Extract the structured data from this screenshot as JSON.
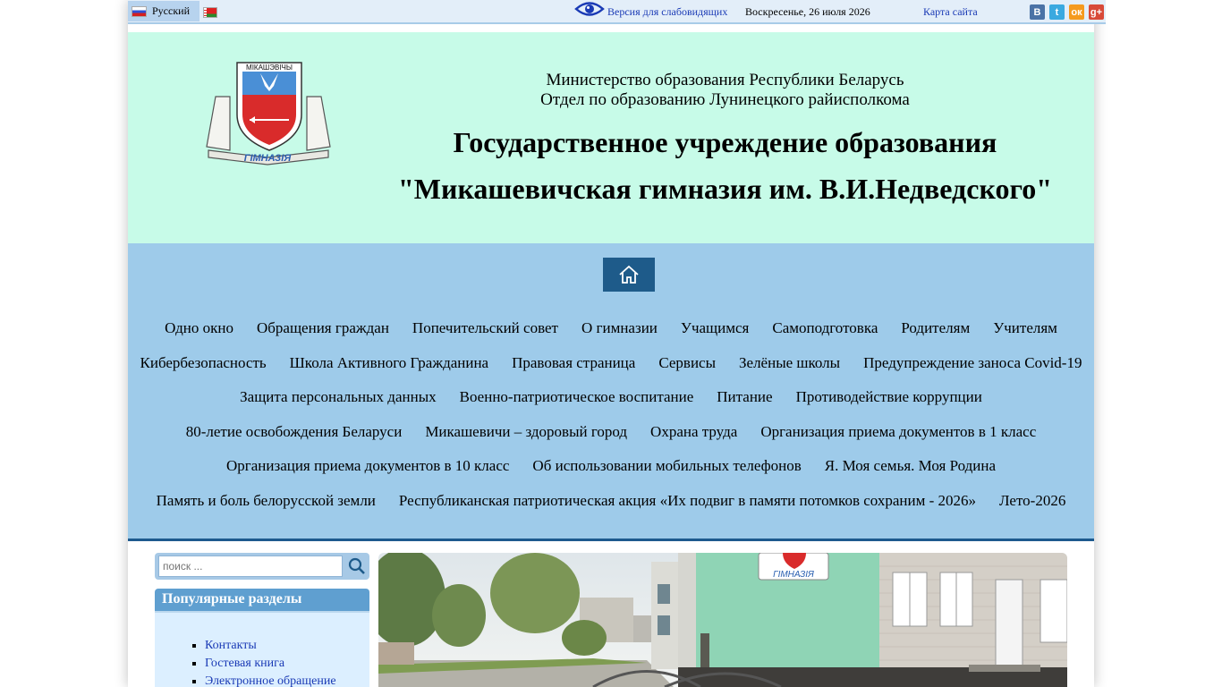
{
  "topbar": {
    "language": "Русский",
    "low_vision_link": "Версия для слабовидящих",
    "date": "Воскресенье, 26 июля 2026",
    "sitemap_link": "Карта сайта",
    "social": {
      "vk": "В",
      "twitter": "t",
      "ok": "ок",
      "gplus": "g+"
    }
  },
  "header": {
    "crest_top_text": "МІКАШЭВІЧЫ",
    "crest_bottom_text": "ГІМНАЗІЯ",
    "ministry": "Министерство образования Республики Беларусь",
    "department": "Отдел по образованию Лунинецкого райисполкома",
    "institution": "Государственное учреждение образования",
    "name": "\"Микашевичская гимназия им. В.И.Недведского\""
  },
  "nav": {
    "rows": [
      [
        "Одно окно",
        "Обращения граждан",
        "Попечительский совет",
        "О гимназии",
        "Учащимся",
        "Самоподготовка",
        "Родителям",
        "Учителям"
      ],
      [
        "Кибербезопасность",
        "Школа Активного Гражданина",
        "Правовая страница",
        "Сервисы",
        "Зелёные школы",
        "Предупреждение заноса Covid-19"
      ],
      [
        "Защита персональных данных",
        "Военно-патриотическое воспитание",
        "Питание",
        "Противодействие коррупции"
      ],
      [
        "80-летие освобождения Беларуси",
        "Микашевичи – здоровый город",
        "Охрана труда",
        "Организация приема документов в 1 класс"
      ],
      [
        "Организация приема документов в 10 класс",
        "Об использовании мобильных телефонов",
        "Я. Моя семья. Моя Родина"
      ],
      [
        "Память и боль белорусской земли",
        "Республиканская патриотическая акция «Их подвиг в памяти потомков сохраним - 2026»",
        "Лето-2026"
      ]
    ]
  },
  "search": {
    "placeholder": "поиск ..."
  },
  "popular": {
    "title": "Популярные разделы",
    "items": [
      "Контакты",
      "Гостевая книга",
      "Электронное обращение"
    ]
  },
  "photo": {
    "sign_text": "ГІМНАЗІЯ"
  },
  "colors": {
    "header_bg": "#c7fbe8",
    "nav_bg": "#9ecbea",
    "home_btn": "#1e5b8a",
    "link": "#1a3ab5"
  }
}
